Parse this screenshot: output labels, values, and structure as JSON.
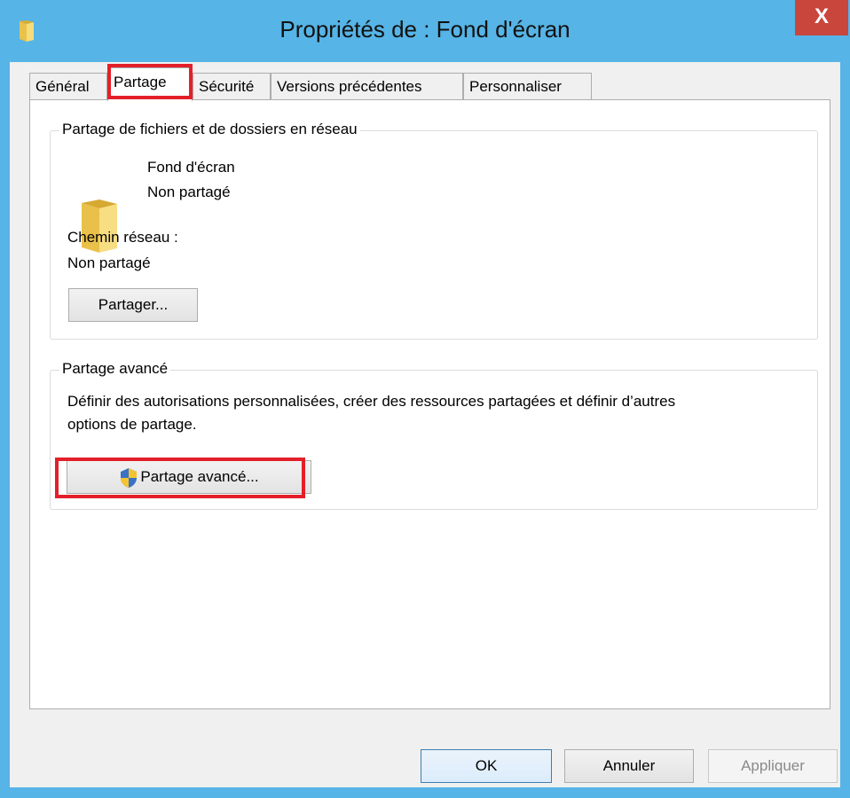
{
  "window": {
    "title": "Propriétés de : Fond d'écran",
    "close_label": "X"
  },
  "tabs": [
    {
      "label": "Général",
      "active": false
    },
    {
      "label": "Partage",
      "active": true
    },
    {
      "label": "Sécurité",
      "active": false
    },
    {
      "label": "Versions précédentes",
      "active": false
    },
    {
      "label": "Personnaliser",
      "active": false
    }
  ],
  "network_sharing": {
    "legend": "Partage de fichiers et de dossiers en réseau",
    "folder_name": "Fond d'écran",
    "folder_status": "Non partagé",
    "path_label": "Chemin réseau :",
    "path_value": "Non partagé",
    "share_button": "Partager..."
  },
  "advanced_sharing": {
    "legend": "Partage avancé",
    "description_line1": "Définir des autorisations personnalisées, créer des ressources partagées et définir d’autres",
    "description_line2": "options de partage.",
    "button": "Partage avancé..."
  },
  "footer": {
    "ok": "OK",
    "cancel": "Annuler",
    "apply": "Appliquer"
  },
  "colors": {
    "title_bar": "#56b4e6",
    "close_button": "#c9463d",
    "highlight": "#e3202a"
  },
  "icons": {
    "title": "folder-icon",
    "folder": "folder-icon",
    "shield": "uac-shield-icon"
  }
}
